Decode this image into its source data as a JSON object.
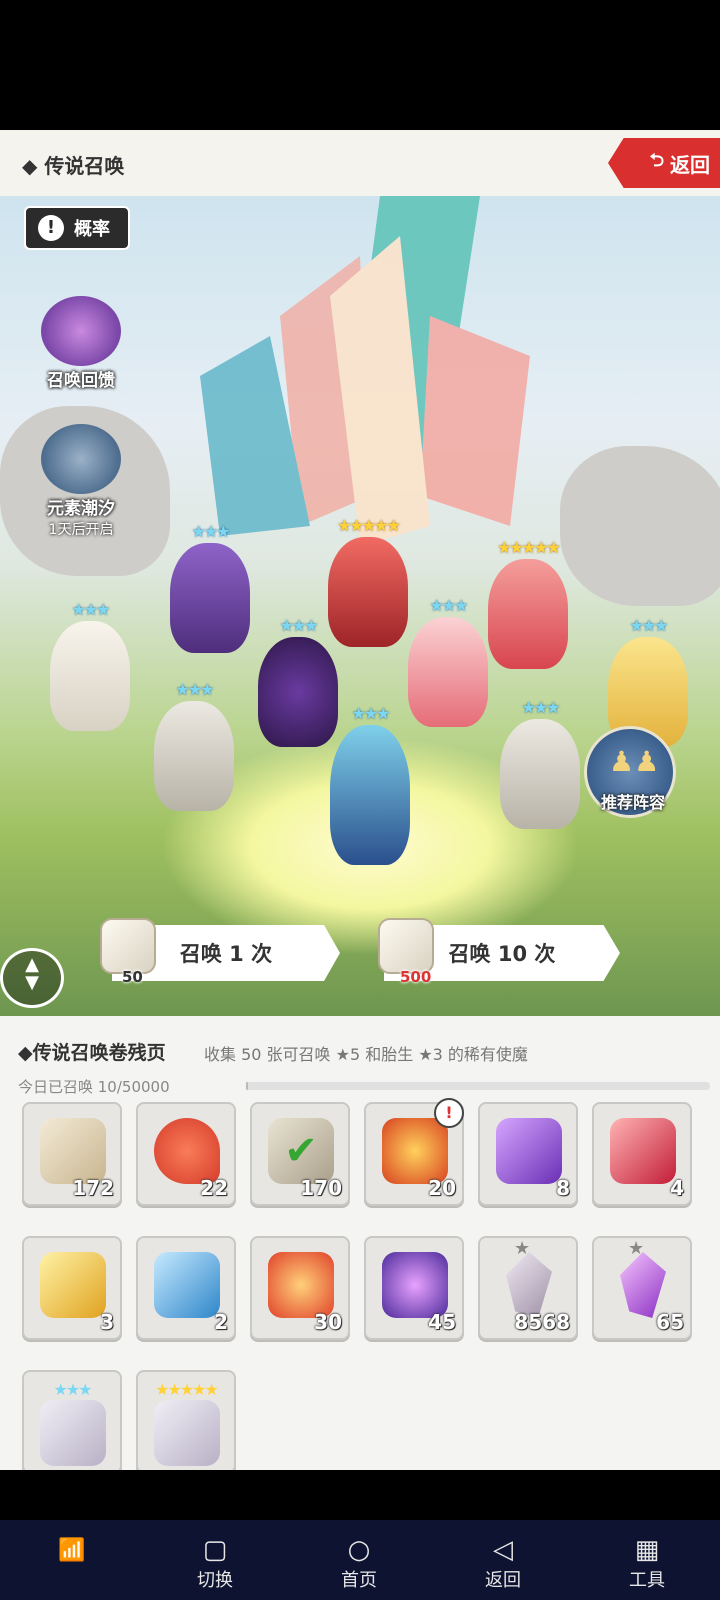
{
  "header": {
    "title": "◆ 传说召唤",
    "back_label": "返回"
  },
  "banner": {
    "probability_label": "概率",
    "summon_feedback_label": "召唤回馈",
    "element_tide_label": "元素潮汐",
    "element_tide_sub": "1天后开启",
    "recommend_label": "推荐阵容"
  },
  "summon": {
    "once_label": "召唤 1 次",
    "once_cost": "50",
    "ten_label": "召唤 10 次",
    "ten_cost": "500"
  },
  "panel": {
    "title": "◆传说召唤卷残页",
    "description": "收集 50 张可召唤 ★5 和胎生 ★3 的稀有使魔",
    "today_label": "今日已召唤 10/50000",
    "today_progress": 0.0002,
    "items": [
      {
        "name": "white-scroll",
        "count": "172"
      },
      {
        "name": "heart",
        "count": "22"
      },
      {
        "name": "check-scroll",
        "count": "170"
      },
      {
        "name": "fire-orb",
        "count": "20",
        "alert": "!"
      },
      {
        "name": "purple-scroll",
        "count": "8"
      },
      {
        "name": "red-scroll",
        "count": "4"
      },
      {
        "name": "gold-scroll",
        "count": "3"
      },
      {
        "name": "blue-scroll",
        "count": "2"
      },
      {
        "name": "orange-orb",
        "count": "30"
      },
      {
        "name": "violet-orb",
        "count": "45"
      },
      {
        "name": "gray-crystal",
        "count": "8568",
        "star": "★"
      },
      {
        "name": "purple-crystal",
        "count": "65",
        "star": "★"
      },
      {
        "name": "silver-ring-3star",
        "count": "",
        "stars": "★★★"
      },
      {
        "name": "silver-ring-5star",
        "count": "",
        "stars": "★★★★★"
      }
    ]
  },
  "navbar": {
    "switch": "切换",
    "home": "首页",
    "back": "返回",
    "tools": "工具"
  }
}
